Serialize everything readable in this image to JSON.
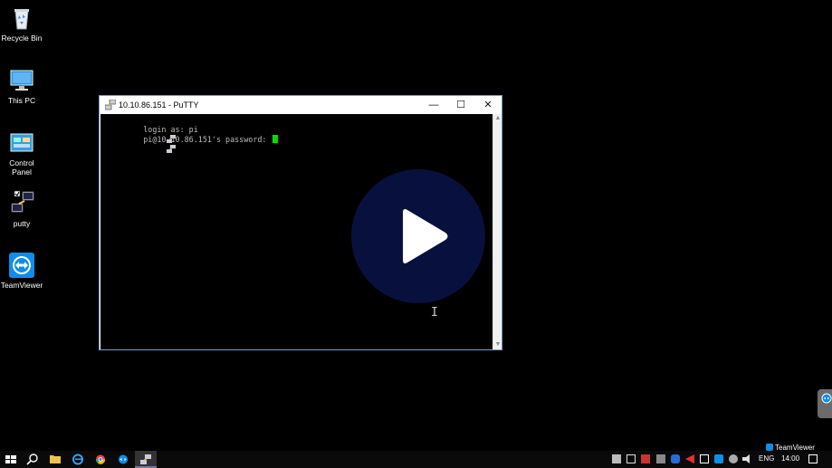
{
  "desktop": {
    "icons": [
      {
        "label": "Recycle Bin",
        "icon": "recycle-bin-icon"
      },
      {
        "label": "This PC",
        "icon": "computer-icon"
      },
      {
        "label": "Control\nPanel",
        "icon": "control-panel-icon"
      },
      {
        "label": "putty",
        "icon": "putty-icon"
      },
      {
        "label": "TeamViewer",
        "icon": "teamviewer-icon"
      }
    ]
  },
  "window": {
    "title": "10.10.86.151 - PuTTY",
    "minimize": "—",
    "maximize": "☐",
    "close": "✕",
    "terminal": {
      "lines": [
        "login as: pi",
        "pi@10.10.86.151's password: "
      ]
    }
  },
  "overlay": {
    "play_icon": "play-icon"
  },
  "taskbar": {
    "language": "ENG",
    "time": "14:00",
    "teamviewer_label": "TeamViewer"
  },
  "colors": {
    "terminal_text": "#bbbbbb",
    "cursor": "#00e000",
    "play_bg": "#081241",
    "window_border": "#7a9cc6"
  }
}
